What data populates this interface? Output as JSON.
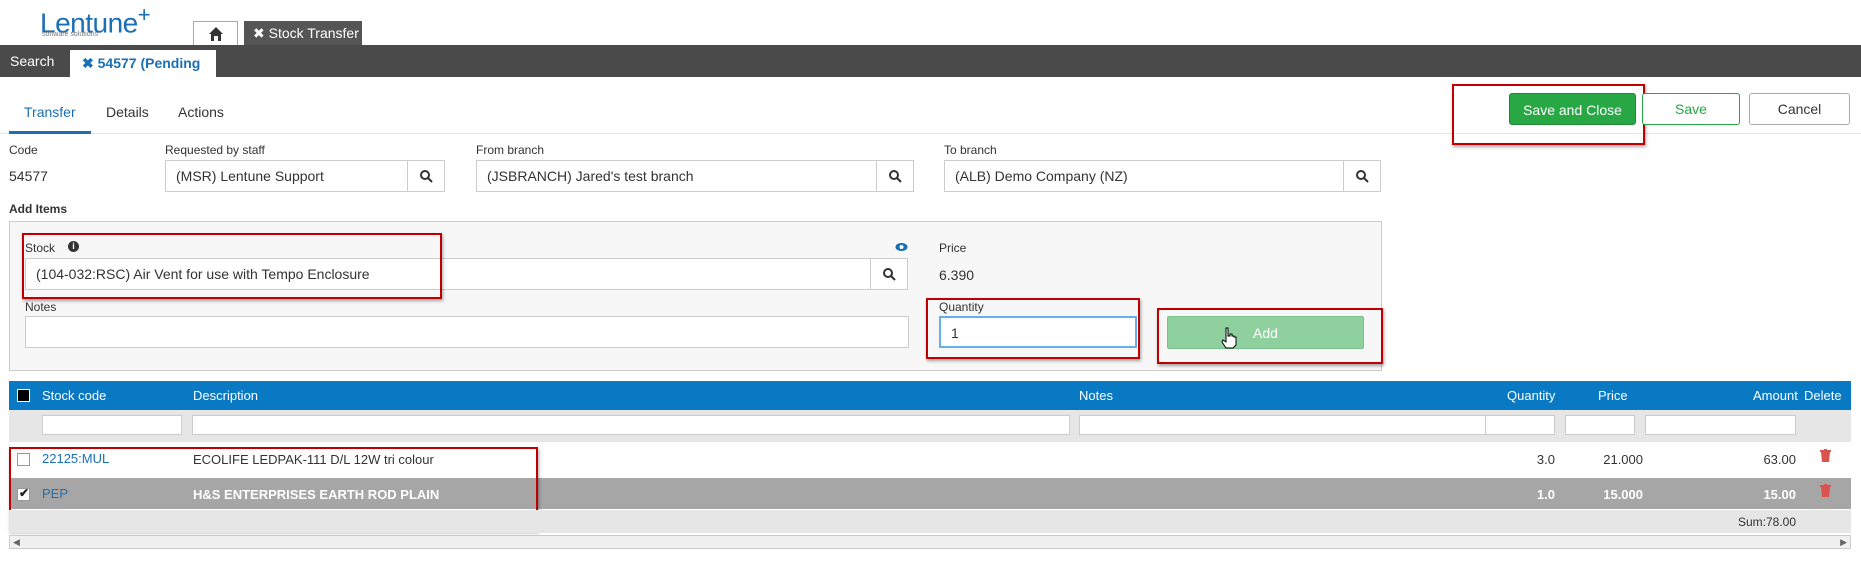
{
  "brand": {
    "name": "Lentune",
    "plus": "+",
    "tagline": "software solutions"
  },
  "top_tabs": {
    "home_icon": "home-icon",
    "stock_transfer": "✖ Stock Transfer"
  },
  "nav": {
    "search": "Search",
    "pending_tab": "✖ 54577 (Pending"
  },
  "subtabs": [
    "Transfer",
    "Details",
    "Actions"
  ],
  "buttons": {
    "save_close": "Save and Close",
    "save": "Save",
    "cancel": "Cancel",
    "add": "Add"
  },
  "form": {
    "code_label": "Code",
    "code_value": "54577",
    "requested_label": "Requested by staff",
    "requested_value": "(MSR) Lentune Support",
    "from_label": "From branch",
    "from_value": "(JSBRANCH) Jared's test branch",
    "to_label": "To branch",
    "to_value": "(ALB) Demo Company (NZ)",
    "add_items_label": "Add Items",
    "stock_label": "Stock",
    "stock_value": "(104-032:RSC) Air Vent for use with Tempo Enclosure",
    "price_label": "Price",
    "price_value": "6.390",
    "notes_label": "Notes",
    "notes_value": "",
    "quantity_label": "Quantity",
    "quantity_value": "1"
  },
  "table": {
    "headers": {
      "stock_code": "Stock code",
      "description": "Description",
      "notes": "Notes",
      "quantity": "Quantity",
      "price": "Price",
      "amount": "Amount",
      "delete": "Delete"
    },
    "rows": [
      {
        "code": "22125:MUL",
        "description": "ECOLIFE LEDPAK-111 D/L 12W tri colour",
        "notes": "",
        "quantity": "3.0",
        "price": "21.000",
        "amount": "63.00",
        "checked": false
      },
      {
        "code": "PEP",
        "description": "H&S ENTERPRISES EARTH ROD PLAIN",
        "notes": "",
        "quantity": "1.0",
        "price": "15.000",
        "amount": "15.00",
        "checked": true
      }
    ],
    "sum": "Sum:78.00"
  },
  "colors": {
    "accent": "#1a6fb5",
    "header_blue": "#0a79c4",
    "save_green": "#28a745",
    "add_green": "#8fd19e",
    "highlight_red": "#c00000"
  }
}
